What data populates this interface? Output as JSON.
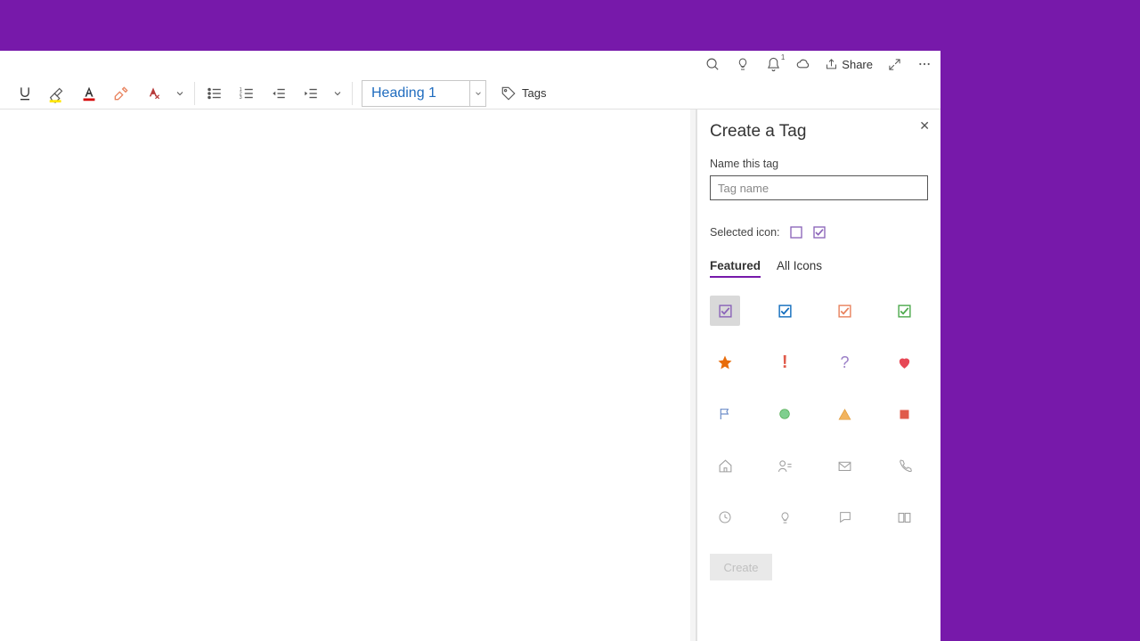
{
  "titlebar": {
    "share_label": "Share",
    "notif_badge": "1"
  },
  "ribbon": {
    "style_label": "Heading 1",
    "tags_label": "Tags"
  },
  "panel": {
    "title": "Create a Tag",
    "name_label": "Name this tag",
    "name_placeholder": "Tag name",
    "name_value": "",
    "selected_icon_label": "Selected icon:",
    "tabs": {
      "featured": "Featured",
      "all": "All Icons"
    },
    "create_label": "Create"
  },
  "icons": {
    "checkbox_purple": "checkbox-purple",
    "checkbox_blue": "checkbox-blue",
    "checkbox_orange": "checkbox-orange",
    "checkbox_green": "checkbox-green",
    "star": "star",
    "exclaim": "exclamation",
    "question": "question",
    "heart": "heart",
    "flag": "flag",
    "circle_green": "circle-green",
    "triangle_yellow": "triangle-yellow",
    "square_red": "square-red",
    "home": "home",
    "contact": "contact",
    "mail": "mail",
    "phone": "phone",
    "clock": "clock",
    "bulb": "lightbulb",
    "chat": "chat",
    "book": "book"
  },
  "colors": {
    "accent_purple": "#7719aa",
    "blue": "#0f6cbd",
    "orange": "#e8825d",
    "green": "#4da94d",
    "star_orange": "#e86c0a",
    "pale_orange": "#f2a95f",
    "red": "#e74856",
    "heart_red": "#e74856",
    "square_red": "#e05b4b",
    "circle_green": "#7fcf8e",
    "gray": "#9e9e9e"
  }
}
